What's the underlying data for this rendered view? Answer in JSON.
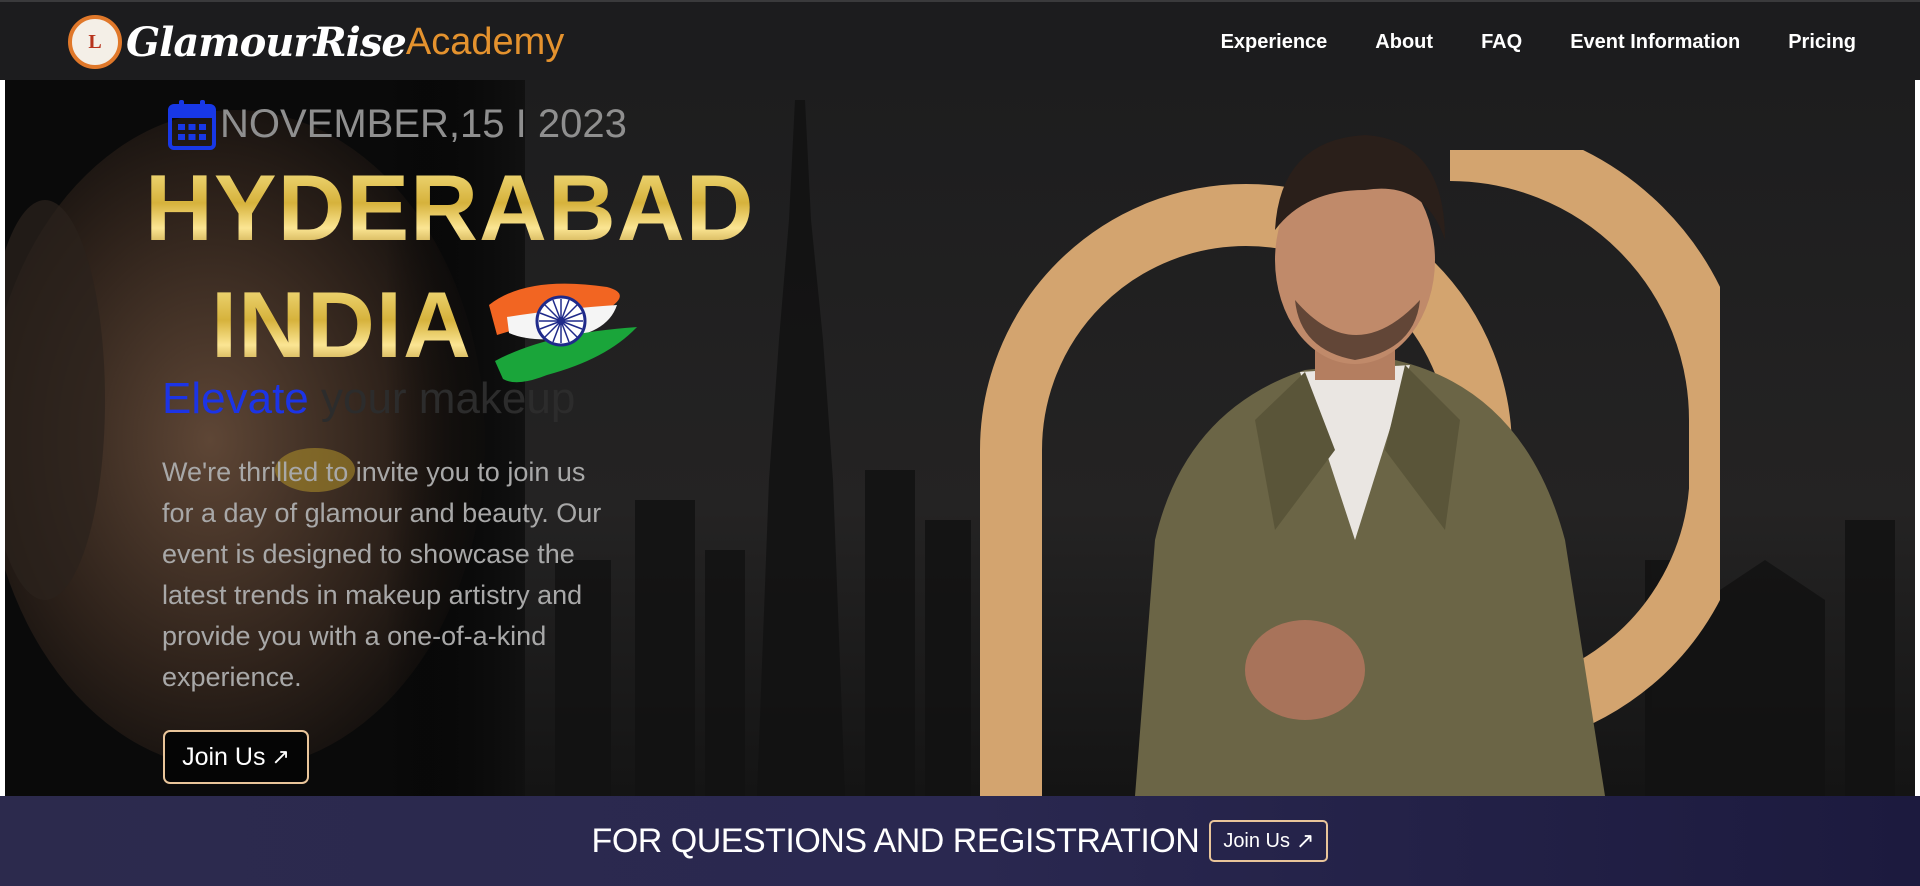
{
  "brand": {
    "name": "GlamourRise",
    "suffix": "Academy",
    "badge_mark": "L"
  },
  "nav": {
    "items": [
      {
        "label": "Experience"
      },
      {
        "label": "About"
      },
      {
        "label": "FAQ"
      },
      {
        "label": "Event Information"
      },
      {
        "label": "Pricing"
      }
    ]
  },
  "hero": {
    "date": "NOVEMBER,15 I 2023",
    "city": "HYDERABAD",
    "country": "INDIA",
    "tagline_accent": "Elevate",
    "tagline_rest": " your makeup",
    "intro": "We're thrilled to invite you to join us for a day of glamour and beauty. Our event is designed to showcase the latest trends in makeup artistry and provide you with a one-of-a-kind experience.",
    "join_label": "Join Us",
    "join_arrow": "↗"
  },
  "banner": {
    "text": "FOR QUESTIONS AND REGISTRATION",
    "join_label": "Join Us",
    "join_arrow": "↗"
  },
  "icons": {
    "calendar": "calendar-icon",
    "flag": "india-flag-icon",
    "arrow": "arrow-up-right-icon"
  },
  "colors": {
    "nav_bg": "#1c1c1e",
    "gold": "#d6b23c",
    "accent_blue": "#1c34e6",
    "monogram": "#d3a46f",
    "banner_bg": "#2a2850",
    "button_border": "#e9c59a"
  }
}
